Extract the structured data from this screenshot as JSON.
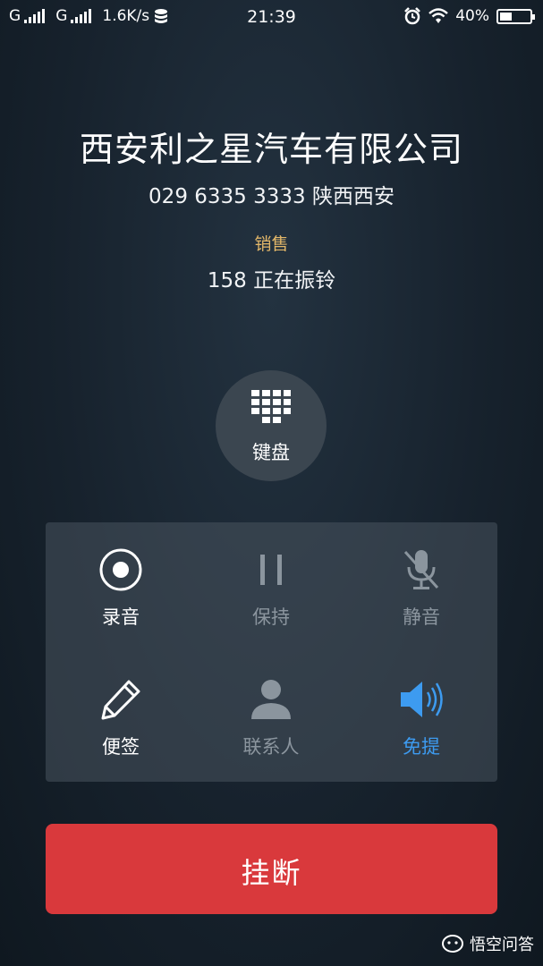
{
  "status_bar": {
    "sim1_label": "G",
    "sim2_label": "G",
    "net_speed": "1.6K/s",
    "time": "21:39",
    "battery_percent": "40%",
    "battery_level": 0.4
  },
  "caller": {
    "name": "西安利之星汽车有限公司",
    "number_location": "029 6335 3333 陕西西安",
    "tag": "销售",
    "status": "158 正在振铃"
  },
  "keypad": {
    "label": "键盘",
    "icon": "dialpad-icon"
  },
  "controls": {
    "record": {
      "label": "录音",
      "icon": "record-icon"
    },
    "hold": {
      "label": "保持",
      "icon": "pause-icon"
    },
    "mute": {
      "label": "静音",
      "icon": "mic-off-icon"
    },
    "notes": {
      "label": "便签",
      "icon": "pencil-icon"
    },
    "contacts": {
      "label": "联系人",
      "icon": "person-icon"
    },
    "speaker": {
      "label": "免提",
      "icon": "speaker-icon"
    }
  },
  "hangup": {
    "label": "挂断"
  },
  "watermark": {
    "text": "悟空问答"
  },
  "colors": {
    "hangup": "#d9393c",
    "speaker_active": "#3d9bf0",
    "tag": "#e3b769",
    "disabled": "#8b959e"
  }
}
